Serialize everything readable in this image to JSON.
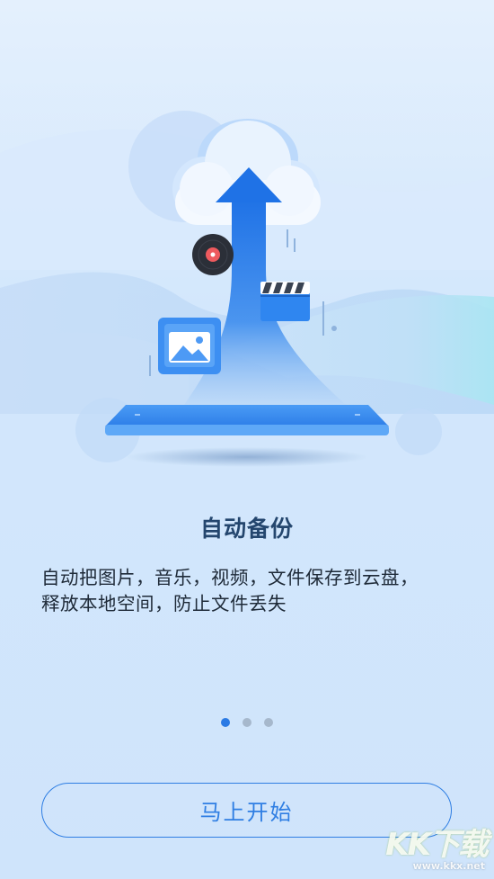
{
  "onboarding": {
    "title": "自动备份",
    "description_line1": "自动把图片，音乐，视频，文件保存到云盘，",
    "description_line2": "释放本地空间，防止文件丢失",
    "pages": 3,
    "active_page": 1,
    "start_button_label": "马上开始"
  },
  "watermark": {
    "logo_text": "KK下载",
    "url": "www.kkx.net"
  },
  "colors": {
    "accent": "#2f7ee3",
    "title": "#24466e",
    "text": "#1e2a38",
    "dot_active": "#2a7ae4",
    "dot_inactive": "#a6b8cc"
  },
  "icons": [
    "cloud-icon",
    "upload-arrow-icon",
    "vinyl-record-icon",
    "clapperboard-icon",
    "photo-gallery-icon",
    "phone-platform-icon"
  ]
}
